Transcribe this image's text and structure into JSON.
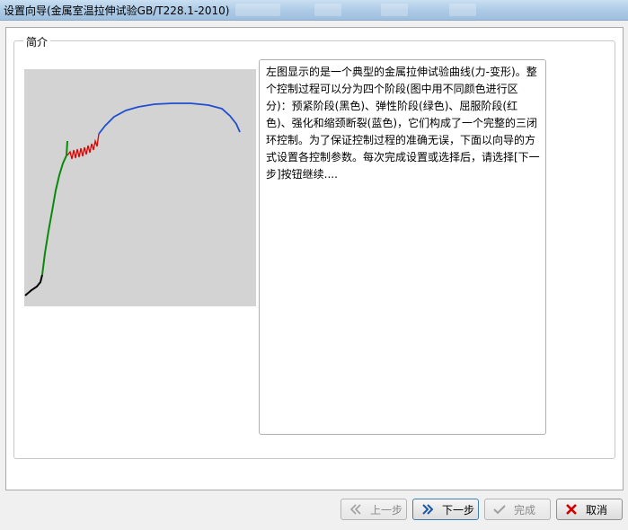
{
  "window": {
    "title": "设置向导(金属室温拉伸试验GB/T228.1-2010)"
  },
  "intro": {
    "group_label": "简介",
    "description": "左图显示的是一个典型的金属拉伸试验曲线(力-变形)。整个控制过程可以分为四个阶段(图中用不同颜色进行区分)：预紧阶段(黑色)、弹性阶段(绿色)、屈服阶段(红色)、强化和缩颈断裂(蓝色)，它们构成了一个完整的三闭环控制。为了保证控制过程的准确无误，下面以向导的方式设置各控制参数。每次完成设置或选择后，请选择[下一步]按钮继续...."
  },
  "curve": {
    "background": "#d3d3d3",
    "stages": [
      {
        "stage": "preload",
        "color": "#000000"
      },
      {
        "stage": "elastic",
        "color": "#0a8a0a"
      },
      {
        "stage": "yield",
        "color": "#e00000"
      },
      {
        "stage": "hardening-necking",
        "color": "#1f4fd0"
      }
    ]
  },
  "buttons": {
    "prev": {
      "label": "上一步",
      "enabled": false,
      "icon": "double-chevron-left-icon"
    },
    "next": {
      "label": "下一步",
      "enabled": true,
      "icon": "double-chevron-right-icon"
    },
    "finish": {
      "label": "完成",
      "enabled": false,
      "icon": "checkmark-icon"
    },
    "cancel": {
      "label": "取消",
      "enabled": true,
      "icon": "close-x-icon"
    }
  }
}
